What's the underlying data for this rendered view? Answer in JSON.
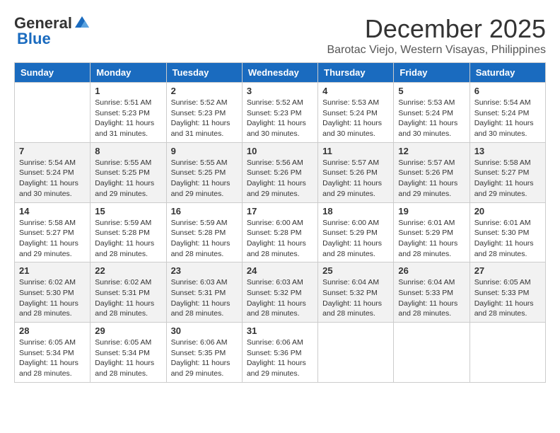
{
  "logo": {
    "general": "General",
    "blue": "Blue"
  },
  "title": {
    "month_year": "December 2025",
    "location": "Barotac Viejo, Western Visayas, Philippines"
  },
  "weekdays": [
    "Sunday",
    "Monday",
    "Tuesday",
    "Wednesday",
    "Thursday",
    "Friday",
    "Saturday"
  ],
  "weeks": [
    [
      {
        "day": "",
        "sunrise": "",
        "sunset": "",
        "daylight": ""
      },
      {
        "day": "1",
        "sunrise": "Sunrise: 5:51 AM",
        "sunset": "Sunset: 5:23 PM",
        "daylight": "Daylight: 11 hours and 31 minutes."
      },
      {
        "day": "2",
        "sunrise": "Sunrise: 5:52 AM",
        "sunset": "Sunset: 5:23 PM",
        "daylight": "Daylight: 11 hours and 31 minutes."
      },
      {
        "day": "3",
        "sunrise": "Sunrise: 5:52 AM",
        "sunset": "Sunset: 5:23 PM",
        "daylight": "Daylight: 11 hours and 30 minutes."
      },
      {
        "day": "4",
        "sunrise": "Sunrise: 5:53 AM",
        "sunset": "Sunset: 5:24 PM",
        "daylight": "Daylight: 11 hours and 30 minutes."
      },
      {
        "day": "5",
        "sunrise": "Sunrise: 5:53 AM",
        "sunset": "Sunset: 5:24 PM",
        "daylight": "Daylight: 11 hours and 30 minutes."
      },
      {
        "day": "6",
        "sunrise": "Sunrise: 5:54 AM",
        "sunset": "Sunset: 5:24 PM",
        "daylight": "Daylight: 11 hours and 30 minutes."
      }
    ],
    [
      {
        "day": "7",
        "sunrise": "Sunrise: 5:54 AM",
        "sunset": "Sunset: 5:24 PM",
        "daylight": "Daylight: 11 hours and 30 minutes."
      },
      {
        "day": "8",
        "sunrise": "Sunrise: 5:55 AM",
        "sunset": "Sunset: 5:25 PM",
        "daylight": "Daylight: 11 hours and 29 minutes."
      },
      {
        "day": "9",
        "sunrise": "Sunrise: 5:55 AM",
        "sunset": "Sunset: 5:25 PM",
        "daylight": "Daylight: 11 hours and 29 minutes."
      },
      {
        "day": "10",
        "sunrise": "Sunrise: 5:56 AM",
        "sunset": "Sunset: 5:26 PM",
        "daylight": "Daylight: 11 hours and 29 minutes."
      },
      {
        "day": "11",
        "sunrise": "Sunrise: 5:57 AM",
        "sunset": "Sunset: 5:26 PM",
        "daylight": "Daylight: 11 hours and 29 minutes."
      },
      {
        "day": "12",
        "sunrise": "Sunrise: 5:57 AM",
        "sunset": "Sunset: 5:26 PM",
        "daylight": "Daylight: 11 hours and 29 minutes."
      },
      {
        "day": "13",
        "sunrise": "Sunrise: 5:58 AM",
        "sunset": "Sunset: 5:27 PM",
        "daylight": "Daylight: 11 hours and 29 minutes."
      }
    ],
    [
      {
        "day": "14",
        "sunrise": "Sunrise: 5:58 AM",
        "sunset": "Sunset: 5:27 PM",
        "daylight": "Daylight: 11 hours and 29 minutes."
      },
      {
        "day": "15",
        "sunrise": "Sunrise: 5:59 AM",
        "sunset": "Sunset: 5:28 PM",
        "daylight": "Daylight: 11 hours and 28 minutes."
      },
      {
        "day": "16",
        "sunrise": "Sunrise: 5:59 AM",
        "sunset": "Sunset: 5:28 PM",
        "daylight": "Daylight: 11 hours and 28 minutes."
      },
      {
        "day": "17",
        "sunrise": "Sunrise: 6:00 AM",
        "sunset": "Sunset: 5:28 PM",
        "daylight": "Daylight: 11 hours and 28 minutes."
      },
      {
        "day": "18",
        "sunrise": "Sunrise: 6:00 AM",
        "sunset": "Sunset: 5:29 PM",
        "daylight": "Daylight: 11 hours and 28 minutes."
      },
      {
        "day": "19",
        "sunrise": "Sunrise: 6:01 AM",
        "sunset": "Sunset: 5:29 PM",
        "daylight": "Daylight: 11 hours and 28 minutes."
      },
      {
        "day": "20",
        "sunrise": "Sunrise: 6:01 AM",
        "sunset": "Sunset: 5:30 PM",
        "daylight": "Daylight: 11 hours and 28 minutes."
      }
    ],
    [
      {
        "day": "21",
        "sunrise": "Sunrise: 6:02 AM",
        "sunset": "Sunset: 5:30 PM",
        "daylight": "Daylight: 11 hours and 28 minutes."
      },
      {
        "day": "22",
        "sunrise": "Sunrise: 6:02 AM",
        "sunset": "Sunset: 5:31 PM",
        "daylight": "Daylight: 11 hours and 28 minutes."
      },
      {
        "day": "23",
        "sunrise": "Sunrise: 6:03 AM",
        "sunset": "Sunset: 5:31 PM",
        "daylight": "Daylight: 11 hours and 28 minutes."
      },
      {
        "day": "24",
        "sunrise": "Sunrise: 6:03 AM",
        "sunset": "Sunset: 5:32 PM",
        "daylight": "Daylight: 11 hours and 28 minutes."
      },
      {
        "day": "25",
        "sunrise": "Sunrise: 6:04 AM",
        "sunset": "Sunset: 5:32 PM",
        "daylight": "Daylight: 11 hours and 28 minutes."
      },
      {
        "day": "26",
        "sunrise": "Sunrise: 6:04 AM",
        "sunset": "Sunset: 5:33 PM",
        "daylight": "Daylight: 11 hours and 28 minutes."
      },
      {
        "day": "27",
        "sunrise": "Sunrise: 6:05 AM",
        "sunset": "Sunset: 5:33 PM",
        "daylight": "Daylight: 11 hours and 28 minutes."
      }
    ],
    [
      {
        "day": "28",
        "sunrise": "Sunrise: 6:05 AM",
        "sunset": "Sunset: 5:34 PM",
        "daylight": "Daylight: 11 hours and 28 minutes."
      },
      {
        "day": "29",
        "sunrise": "Sunrise: 6:05 AM",
        "sunset": "Sunset: 5:34 PM",
        "daylight": "Daylight: 11 hours and 28 minutes."
      },
      {
        "day": "30",
        "sunrise": "Sunrise: 6:06 AM",
        "sunset": "Sunset: 5:35 PM",
        "daylight": "Daylight: 11 hours and 29 minutes."
      },
      {
        "day": "31",
        "sunrise": "Sunrise: 6:06 AM",
        "sunset": "Sunset: 5:36 PM",
        "daylight": "Daylight: 11 hours and 29 minutes."
      },
      {
        "day": "",
        "sunrise": "",
        "sunset": "",
        "daylight": ""
      },
      {
        "day": "",
        "sunrise": "",
        "sunset": "",
        "daylight": ""
      },
      {
        "day": "",
        "sunrise": "",
        "sunset": "",
        "daylight": ""
      }
    ]
  ]
}
